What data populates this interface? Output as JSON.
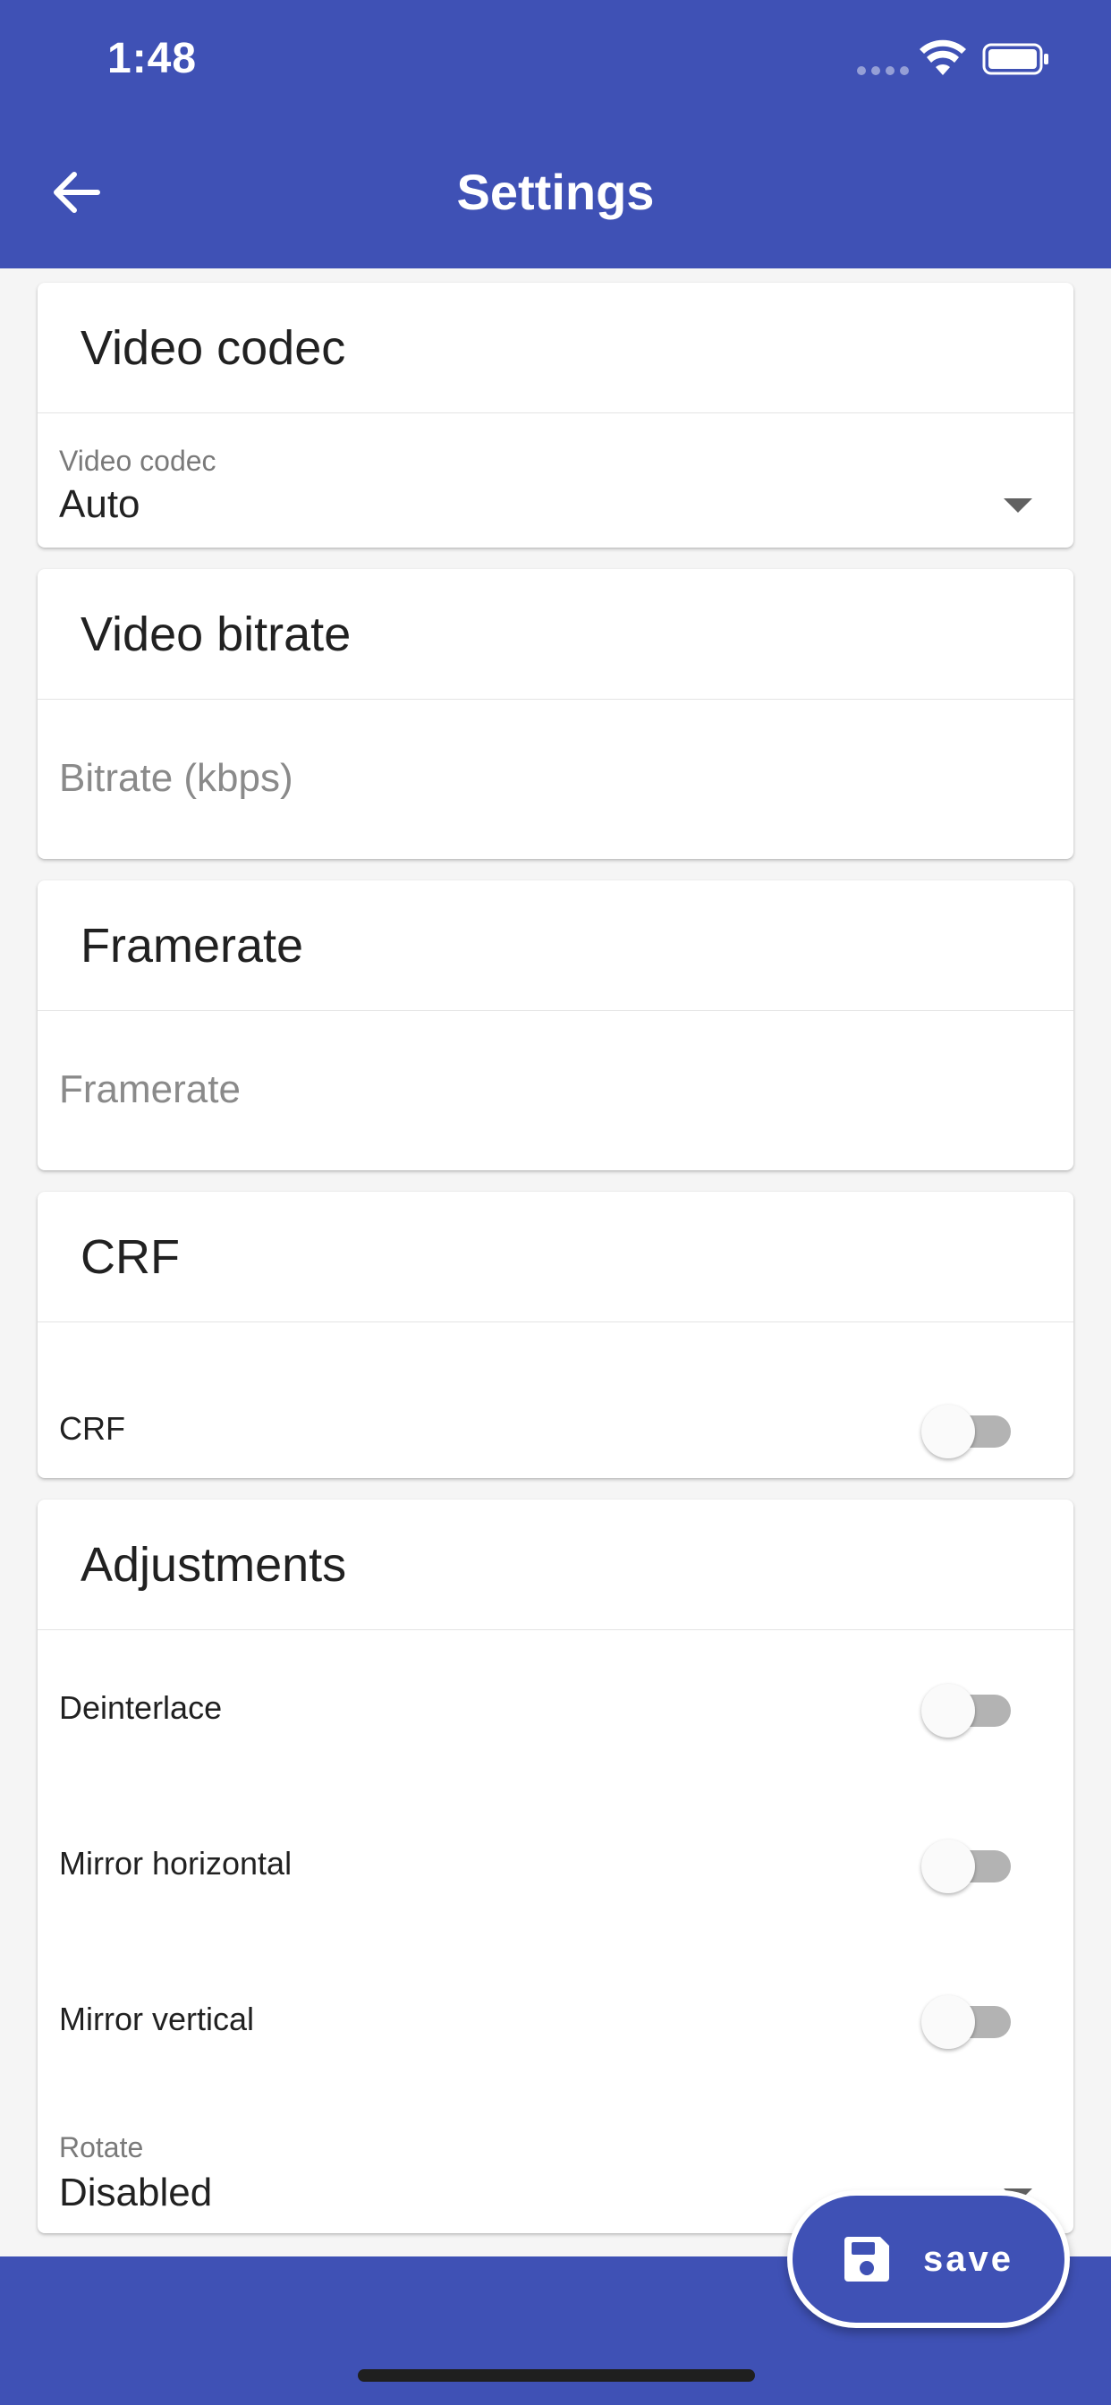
{
  "status_bar": {
    "time": "1:48"
  },
  "appbar": {
    "title": "Settings",
    "back_icon": "arrow-left-icon"
  },
  "cards": {
    "video_codec": {
      "title": "Video codec",
      "field_label": "Video codec",
      "field_value": "Auto"
    },
    "video_bitrate": {
      "title": "Video bitrate",
      "placeholder": "Bitrate (kbps)"
    },
    "framerate": {
      "title": "Framerate",
      "placeholder": "Framerate"
    },
    "crf": {
      "title": "CRF",
      "toggle_label": "CRF",
      "toggle_on": false
    },
    "adjustments": {
      "title": "Adjustments",
      "toggles": [
        {
          "label": "Deinterlace",
          "on": false
        },
        {
          "label": "Mirror horizontal",
          "on": false
        },
        {
          "label": "Mirror vertical",
          "on": false
        }
      ],
      "rotate_label": "Rotate",
      "rotate_value": "Disabled"
    }
  },
  "fab": {
    "label": "save",
    "icon": "floppy-disk-icon"
  },
  "colors": {
    "primary": "#3f51b5",
    "background": "#f5f5f5",
    "toggle_track": "#b3b3b3"
  }
}
